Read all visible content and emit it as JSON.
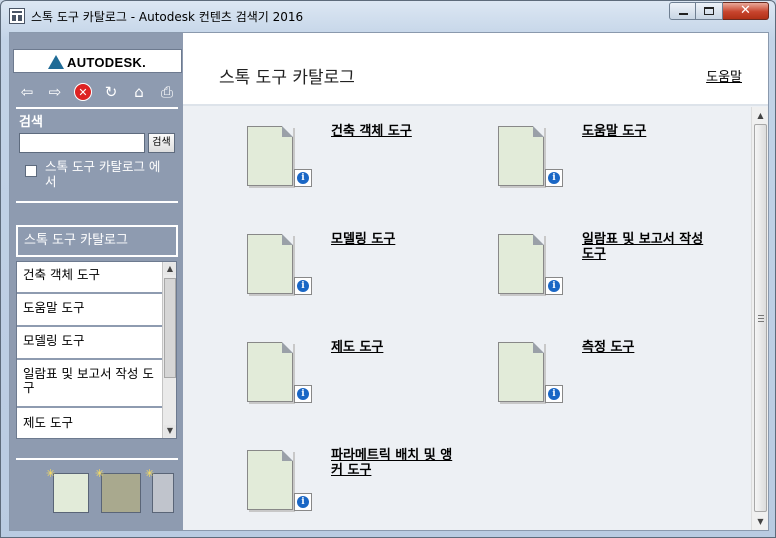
{
  "window": {
    "title": "스톡 도구 카탈로그 - Autodesk 컨텐츠 검색기 2016",
    "minimize_glyph": "–",
    "maximize_glyph": "□",
    "close_glyph": "✕"
  },
  "sidebar": {
    "logo_text": "AUTODESK.",
    "toolbar": [
      {
        "name": "back-icon",
        "glyph": "⇦"
      },
      {
        "name": "forward-icon",
        "glyph": "⇨"
      },
      {
        "name": "stop-icon",
        "glyph": "✕"
      },
      {
        "name": "refresh-icon",
        "glyph": "↻"
      },
      {
        "name": "home-icon",
        "glyph": "⌂"
      },
      {
        "name": "print-icon",
        "glyph": "⎙"
      }
    ],
    "search_label": "검색",
    "search_value": "",
    "search_button": "검색",
    "scope_label": "스톡 도구 카탈로그 에서",
    "category_header": "스톡 도구 카탈로그",
    "category_items": [
      "건축 객체 도구",
      "도움말 도구",
      "모델링 도구",
      "일람표 및 보고서 작성 도구",
      "제도 도구"
    ]
  },
  "main": {
    "title": "스톡 도구 카탈로그",
    "help_link": "도움말",
    "tools": [
      {
        "name": "건축 객체 도구"
      },
      {
        "name": "도움말 도구"
      },
      {
        "name": "모델링 도구"
      },
      {
        "name": "일람표 및 보고서 작성 도구"
      },
      {
        "name": "제도 도구"
      },
      {
        "name": "측정 도구"
      },
      {
        "name": "파라메트릭 배치 및 앵커 도구"
      }
    ],
    "info_glyph": "i"
  },
  "colors": {
    "sidebar_bg": "#8e9bb0",
    "main_bg": "#edf0f4",
    "doc_fill": "#e2ebd9",
    "info_blue": "#1a67c5"
  }
}
